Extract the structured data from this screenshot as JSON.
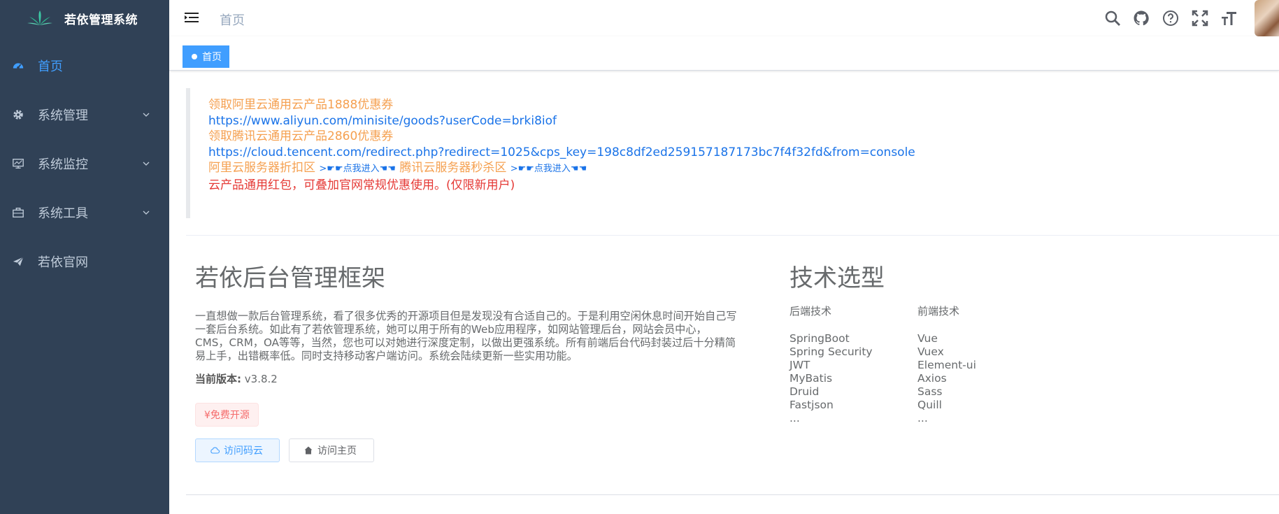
{
  "app": {
    "logo_title": "若依管理系统"
  },
  "sidebar": {
    "items": [
      {
        "label": "首页",
        "icon": "dashboard-icon",
        "active": true
      },
      {
        "label": "系统管理",
        "icon": "gear-icon",
        "expandable": true
      },
      {
        "label": "系统监控",
        "icon": "monitor-icon",
        "expandable": true
      },
      {
        "label": "系统工具",
        "icon": "toolbox-icon",
        "expandable": true
      },
      {
        "label": "若依官网",
        "icon": "paper-plane-icon"
      }
    ]
  },
  "navbar": {
    "breadcrumb": "首页",
    "icons": [
      "search-icon",
      "github-icon",
      "help-icon",
      "fullscreen-icon",
      "font-size-icon"
    ]
  },
  "tags": {
    "active_tag": "首页"
  },
  "notice": {
    "line1": "领取阿里云通用云产品1888优惠券",
    "line2": "https://www.aliyun.com/minisite/goods?userCode=brki8iof",
    "line3": "领取腾讯云通用云产品2860优惠券",
    "line4": "https://cloud.tencent.com/redirect.php?redirect=1025&cps_key=198c8df2ed259157187173bc7f4f32fd&from=console",
    "line5_a": "阿里云服务器折扣区",
    "line5_b": ">☛☛点我进入☚☚",
    "line5_c": "腾讯云服务器秒杀区",
    "line5_d": ">☛☛点我进入☚☚",
    "line6": "云产品通用红包，可叠加官网常规优惠使用。(仅限新用户)"
  },
  "intro": {
    "title": "若依后台管理框架",
    "description": "一直想做一款后台管理系统，看了很多优秀的开源项目但是发现没有合适自己的。于是利用空闲休息时间开始自己写一套后台系统。如此有了若依管理系统，她可以用于所有的Web应用程序，如网站管理后台，网站会员中心，CMS，CRM，OA等等，当然，您也可以对她进行深度定制，以做出更强系统。所有前端后台代码封装过后十分精简易上手，出错概率低。同时支持移动客户端访问。系统会陆续更新一些实用功能。",
    "version_label": "当前版本:",
    "version_value": "v3.8.2",
    "free_badge": "¥免费开源",
    "btn_gitee": "访问码云",
    "btn_home": "访问主页"
  },
  "tech": {
    "title": "技术选型",
    "backend_head": "后端技术",
    "frontend_head": "前端技术",
    "backend": [
      "SpringBoot",
      "Spring Security",
      "JWT",
      "MyBatis",
      "Druid",
      "Fastjson",
      "..."
    ],
    "frontend": [
      "Vue",
      "Vuex",
      "Element-ui",
      "Axios",
      "Sass",
      "Quill",
      "..."
    ]
  },
  "colors": {
    "sidebar_bg": "#304156",
    "accent": "#409eff",
    "orange": "#f5a050",
    "red": "#e53935"
  }
}
